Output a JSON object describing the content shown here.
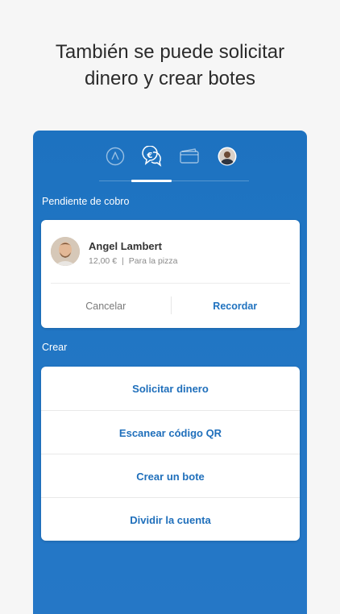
{
  "headline": {
    "line1": "También se puede solicitar",
    "line2": "dinero y crear botes"
  },
  "tabs": {
    "items": [
      {
        "icon": "activity-icon"
      },
      {
        "icon": "euro-chat-icon",
        "active": true
      },
      {
        "icon": "wallet-icon"
      },
      {
        "icon": "profile-avatar"
      }
    ]
  },
  "pending": {
    "section_label": "Pendiente de cobro",
    "name": "Angel Lambert",
    "amount": "12,00 €",
    "separator": "|",
    "concept": "Para la pizza",
    "cancel_label": "Cancelar",
    "remind_label": "Recordar"
  },
  "create": {
    "section_label": "Crear",
    "items": [
      {
        "label": "Solicitar dinero"
      },
      {
        "label": "Escanear código QR"
      },
      {
        "label": "Crear un bote"
      },
      {
        "label": "Dividir la cuenta"
      }
    ]
  },
  "colors": {
    "primary": "#1f72bf",
    "background": "#f6f6f6",
    "card": "#ffffff"
  }
}
